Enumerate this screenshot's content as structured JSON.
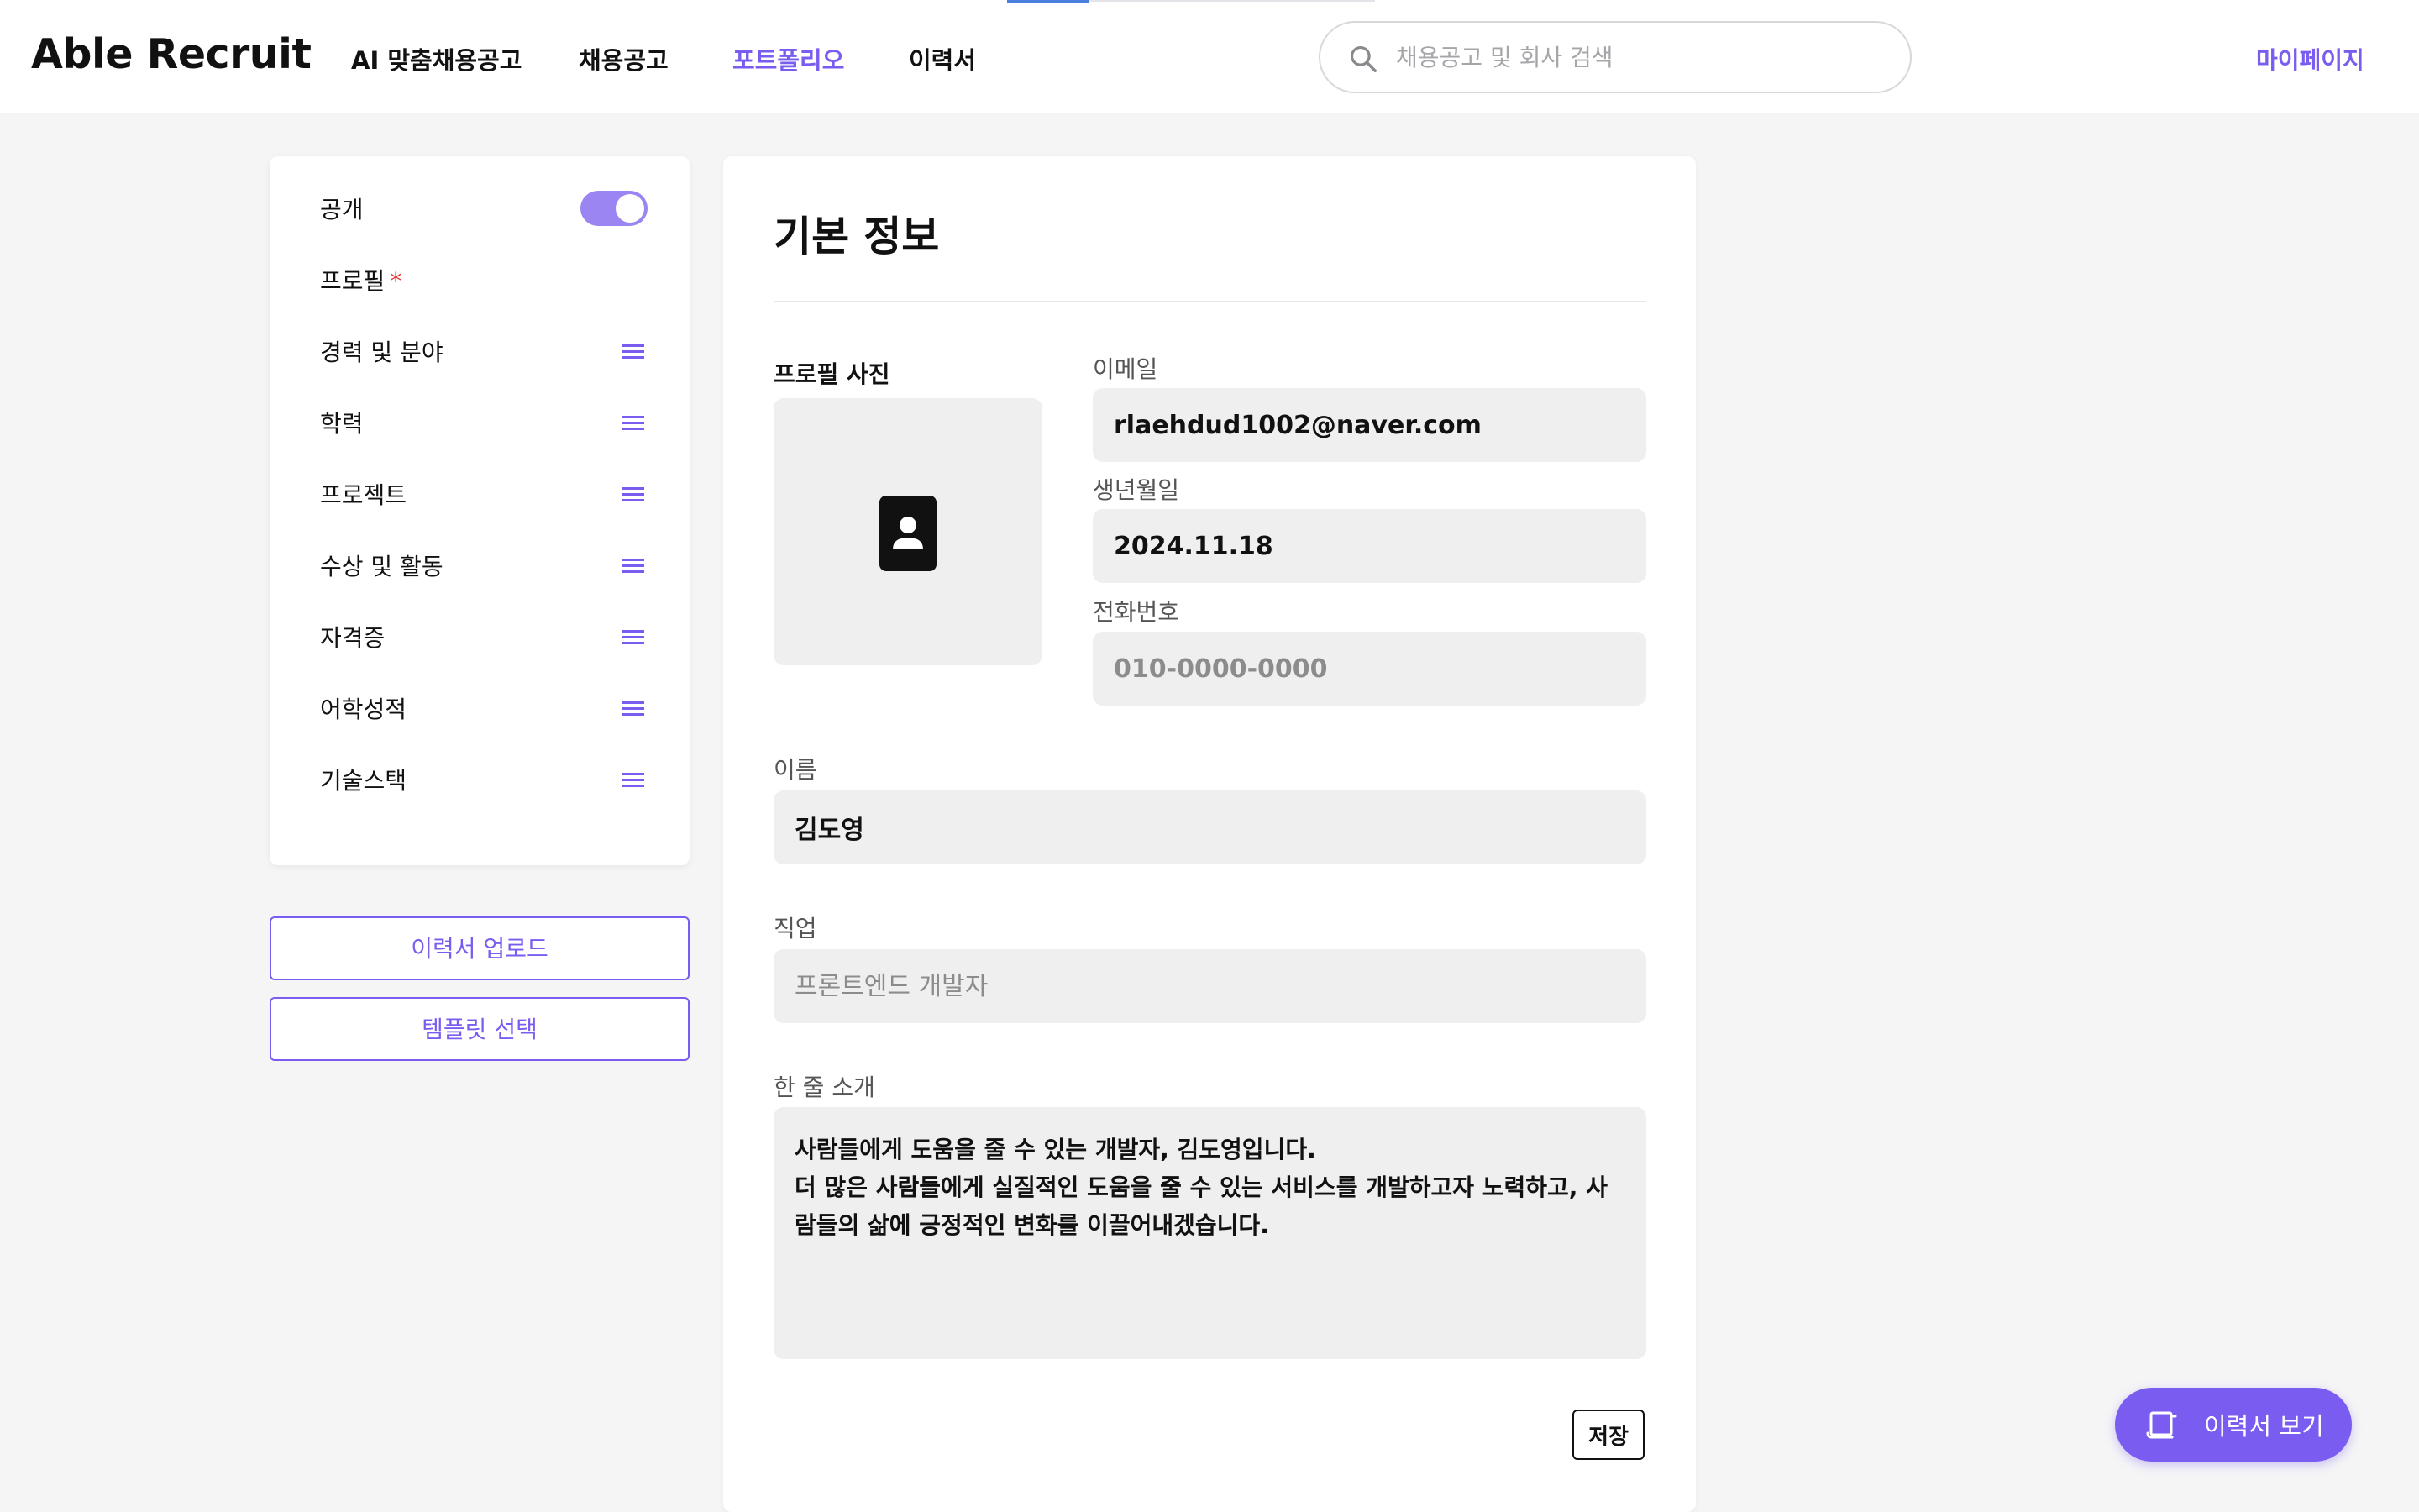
{
  "header": {
    "logo": "Able Recruit",
    "nav": [
      {
        "label": "AI 맞춤채용공고",
        "active": false
      },
      {
        "label": "채용공고",
        "active": false
      },
      {
        "label": "포트폴리오",
        "active": true
      },
      {
        "label": "이력서",
        "active": false
      }
    ],
    "search_placeholder": "채용공고 및 회사 검색",
    "mypage_label": "마이페이지"
  },
  "sidebar": {
    "public_label": "공개",
    "public_on": true,
    "profile_label": "프로필",
    "required_mark": "*",
    "sections": [
      {
        "label": "경력 및 분야"
      },
      {
        "label": "학력"
      },
      {
        "label": "프로젝트"
      },
      {
        "label": "수상 및 활동"
      },
      {
        "label": "자격증"
      },
      {
        "label": "어학성적"
      },
      {
        "label": "기술스택"
      }
    ],
    "upload_button": "이력서 업로드",
    "template_button": "템플릿 선택"
  },
  "main": {
    "title": "기본 정보",
    "photo_label": "프로필 사진",
    "email": {
      "label": "이메일",
      "value": "rlaehdud1002@naver.com"
    },
    "birth": {
      "label": "생년월일",
      "value": "2024.11.18"
    },
    "phone": {
      "label": "전화번호",
      "placeholder": "010-0000-0000"
    },
    "name": {
      "label": "이름",
      "value": "김도영"
    },
    "job": {
      "label": "직업",
      "placeholder": "프론트엔드 개발자"
    },
    "intro": {
      "label": "한 줄 소개",
      "value": "사람들에게 도움을 줄 수 있는 개발자, 김도영입니다.\n더 많은 사람들에게 실질적인 도움을 줄 수 있는 서비스를 개발하고자 노력하고, 사람들의 삶에 긍정적인 변화를 이끌어내겠습니다."
    },
    "save_label": "저장"
  },
  "fab": {
    "label": "이력서 보기"
  },
  "colors": {
    "accent": "#7b5cf0",
    "toggle": "#9a85f2",
    "required": "#e53935"
  }
}
